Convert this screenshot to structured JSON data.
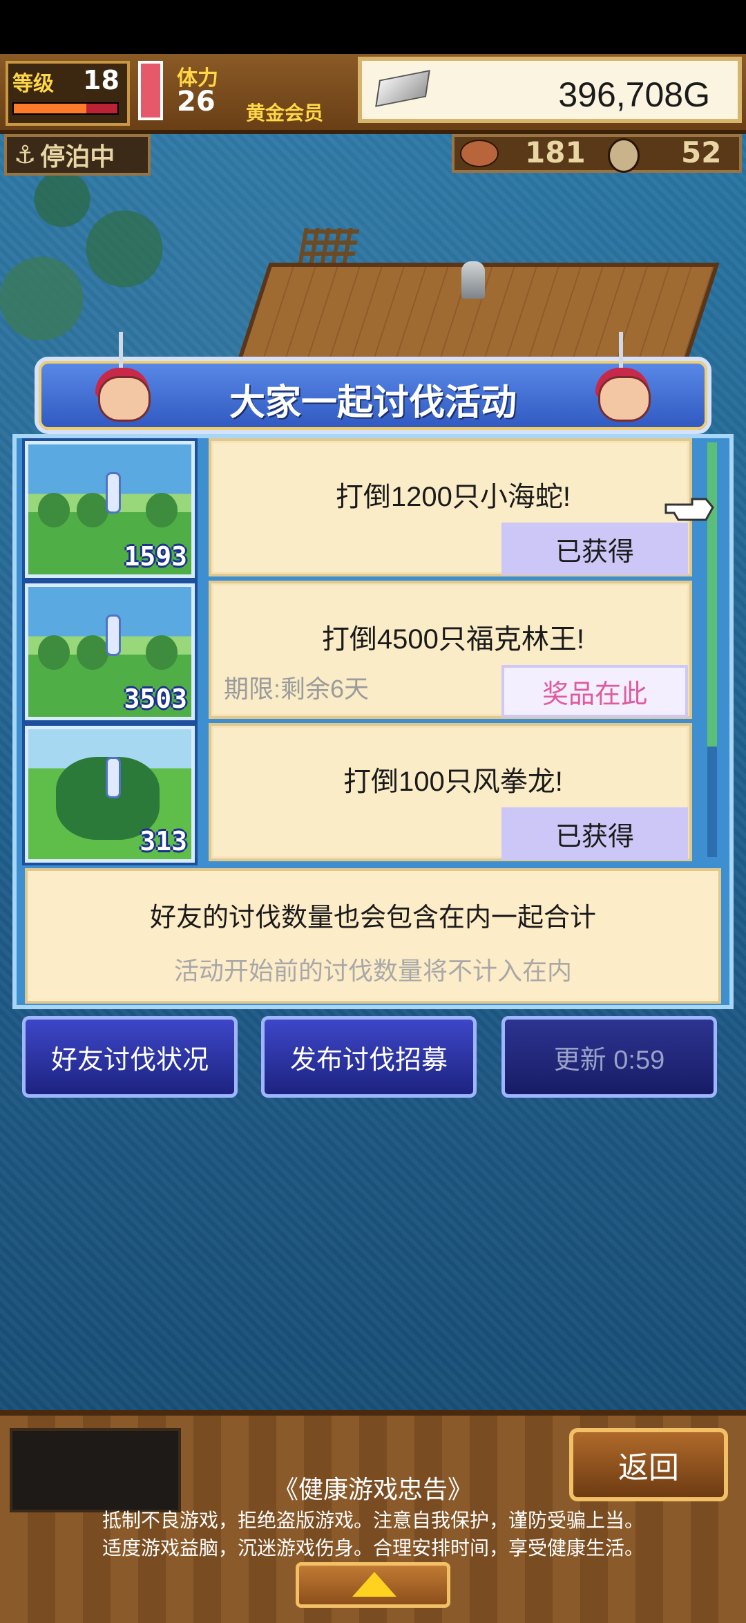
{
  "hud": {
    "level_label": "等级",
    "level_value": "18",
    "xp_progress": 0.7,
    "stamina_label": "体力",
    "stamina_value": "26",
    "membership": "黄金会员",
    "gold": "396,708G",
    "mode": "停泊中",
    "resource_1": "181",
    "resource_2": "52"
  },
  "dialog": {
    "title": "大家一起讨伐活动",
    "missions": [
      {
        "count": "1593",
        "text": "打倒1200只小海蛇!",
        "status": "已获得",
        "deadline": ""
      },
      {
        "count": "3503",
        "text": "打倒4500只福克林王!",
        "status": "奖品在此",
        "deadline": "期限:剩余6天"
      },
      {
        "count": "313",
        "text": "打倒100只风拳龙!",
        "status": "已获得",
        "deadline": ""
      }
    ],
    "note_main": "好友的讨伐数量也会包含在内一起合计",
    "note_sub": "活动开始前的讨伐数量将不计入在内",
    "buttons": {
      "friends_status": "好友讨伐状况",
      "post_recruit": "发布讨伐招募",
      "refresh": "更新 0:59"
    }
  },
  "footer": {
    "back_label": "返回",
    "health_title": "《健康游戏忠告》",
    "health_line1": "抵制不良游戏，拒绝盗版游戏。注意自我保护，谨防受骗上当。",
    "health_line2": "适度游戏益脑，沉迷游戏伤身。合理安排时间，享受健康生活。"
  },
  "icons": {
    "anchor": "anchor-icon",
    "pointer": "pointing-hand-icon",
    "expand": "triangle-up-icon"
  }
}
